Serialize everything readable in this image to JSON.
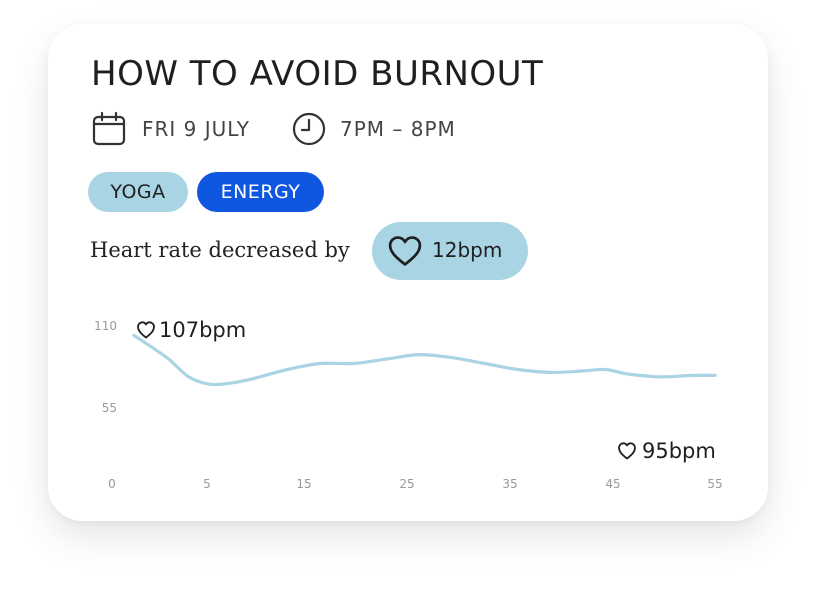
{
  "event": {
    "title": "HOW TO AVOID BURNOUT",
    "date": "FRI 9 JULY",
    "time": "7PM – 8PM"
  },
  "tags": [
    {
      "label": "YOGA",
      "color": "#a9d4e4"
    },
    {
      "label": "ENERGY",
      "color": "#0f57e0"
    }
  ],
  "heart_rate": {
    "label": "Heart rate decreased by",
    "change": "12bpm"
  },
  "icons": {
    "date": "calendar-icon",
    "time": "clock-icon",
    "heart": "heart-icon"
  },
  "colors": {
    "line": "#a9d4e4",
    "energy_tag": "#0f57e0",
    "pill": "#a9d4e4"
  },
  "chart_data": {
    "type": "line",
    "x_ticks": [
      "0",
      "5",
      "15",
      "25",
      "35",
      "45",
      "55"
    ],
    "y_ticks": [
      "110",
      "55"
    ],
    "start_annotation": "107bpm",
    "end_annotation": "95bpm",
    "series": [
      {
        "points": [
          [
            2,
            103
          ],
          [
            5,
            88
          ],
          [
            7,
            75
          ],
          [
            9,
            70
          ],
          [
            11,
            71
          ],
          [
            13,
            74
          ],
          [
            16,
            80
          ],
          [
            19,
            84
          ],
          [
            22,
            84
          ],
          [
            25,
            87
          ],
          [
            28,
            90
          ],
          [
            31,
            88
          ],
          [
            34,
            84
          ],
          [
            37,
            80
          ],
          [
            40,
            78
          ],
          [
            43,
            79
          ],
          [
            45,
            80
          ],
          [
            47,
            77
          ],
          [
            50,
            75
          ],
          [
            53,
            76
          ],
          [
            55,
            76
          ]
        ]
      }
    ]
  }
}
